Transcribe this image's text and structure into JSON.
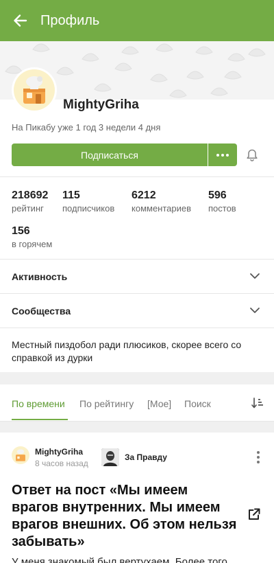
{
  "header": {
    "title": "Профиль",
    "back_icon": "arrow-left-icon"
  },
  "profile": {
    "username": "MightyGriha",
    "since": "На Пикабу уже 1 год 3 недели 4 дня",
    "subscribe_label": "Подписаться",
    "more_icon": "ellipsis-icon",
    "bell_icon": "bell-icon"
  },
  "stats": [
    {
      "value": "218692",
      "label": "рейтинг"
    },
    {
      "value": "115",
      "label": "подписчиков"
    },
    {
      "value": "6212",
      "label": "комментариев"
    },
    {
      "value": "596",
      "label": "постов"
    },
    {
      "value": "156",
      "label": "в горячем"
    }
  ],
  "sections": {
    "activity": "Активность",
    "communities": "Сообщества"
  },
  "bio": "Местный пиздобол ради плюсиков, скорее всего со справкой из дурки",
  "tabs": {
    "by_time": "По времени",
    "by_rating": "По рейтингу",
    "mine": "[Мое]",
    "search": "Поиск",
    "sort_icon": "sort-icon"
  },
  "post": {
    "author": "MightyGriha",
    "time": "8 часов назад",
    "community": "За Правду",
    "title": "Ответ на пост «Мы имеем врагов внутренних. Мы имеем врагов внешних. Об этом нельзя забывать»",
    "excerpt": "У меня знакомый был вертухаем. Более того"
  },
  "colors": {
    "accent": "#74ac45",
    "accent_text": "#5e9b32"
  }
}
